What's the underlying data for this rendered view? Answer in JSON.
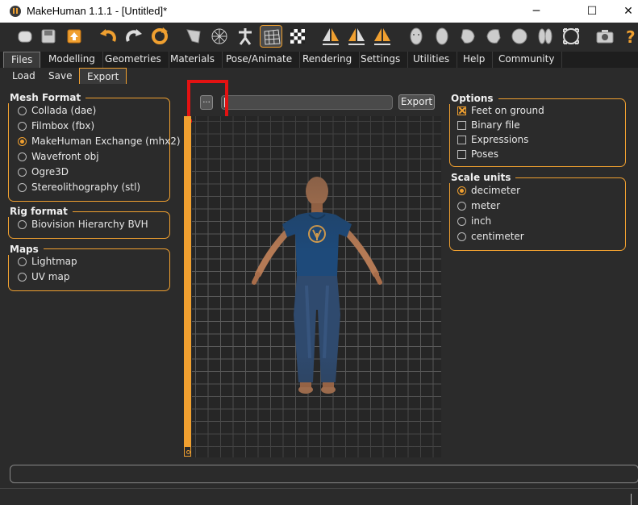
{
  "window": {
    "title": "MakeHuman 1.1.1 - [Untitled]*",
    "minimize": "─",
    "maximize": "☐",
    "close": "✕"
  },
  "toolbar": {
    "icons": [
      "new-icon",
      "save-icon",
      "export-file-icon",
      "undo-icon",
      "redo-icon",
      "reset-icon",
      "smooth-icon",
      "wireframe-icon",
      "skeleton-icon",
      "grid-icon",
      "checkerboard-icon",
      "symmetry-right-icon",
      "symmetry-left-icon",
      "symmetry-icon",
      "front-view-icon",
      "back-view-icon",
      "left-view-icon",
      "right-view-icon",
      "top-view-icon",
      "bottom-view-icon",
      "reset-camera-icon",
      "screenshot-icon",
      "help-icon"
    ],
    "active": "grid-icon"
  },
  "tabs": [
    "Files",
    "Modelling",
    "Geometries",
    "Materials",
    "Pose/Animate",
    "Rendering",
    "Settings",
    "Utilities",
    "Help",
    "Community"
  ],
  "active_tab": "Files",
  "subtabs": [
    "Load",
    "Save",
    "Export"
  ],
  "active_subtab": "Export",
  "mesh_format": {
    "title": "Mesh Format",
    "options": [
      "Collada (dae)",
      "Filmbox (fbx)",
      "MakeHuman Exchange (mhx2)",
      "Wavefront obj",
      "Ogre3D",
      "Stereolithography (stl)"
    ],
    "selected": "MakeHuman Exchange (mhx2)"
  },
  "rig_format": {
    "title": "Rig format",
    "options": [
      "Biovision Hierarchy BVH"
    ]
  },
  "maps": {
    "title": "Maps",
    "options": [
      "Lightmap",
      "UV map"
    ]
  },
  "export_bar": {
    "browse_label": "...",
    "path_value": "",
    "export_label": "Export"
  },
  "options": {
    "title": "Options",
    "items": [
      {
        "label": "Feet on ground",
        "checked": true
      },
      {
        "label": "Binary file",
        "checked": false
      },
      {
        "label": "Expressions",
        "checked": false
      },
      {
        "label": "Poses",
        "checked": false
      }
    ]
  },
  "scale_units": {
    "title": "Scale units",
    "options": [
      "decimeter",
      "meter",
      "inch",
      "centimeter"
    ],
    "selected": "decimeter"
  },
  "colors": {
    "accent": "#f0a030",
    "background": "#2b2b2b",
    "highlight": "#e31212",
    "shirt": "#1e4a7a",
    "jeans": "#2f4a6e",
    "skin": "#b57a55"
  }
}
